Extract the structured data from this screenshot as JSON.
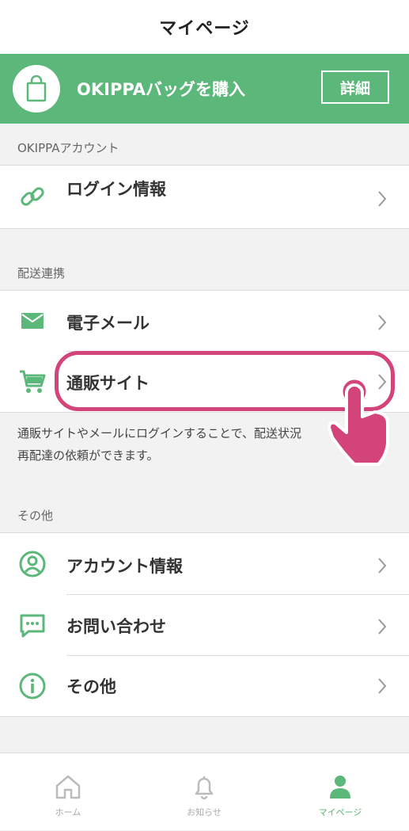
{
  "header": {
    "title": "マイページ"
  },
  "banner": {
    "text": "OKIPPAバッグを購入",
    "detail_button": "詳細"
  },
  "sections": {
    "account": {
      "label": "OKIPPAアカウント"
    },
    "delivery": {
      "label": "配送連携"
    },
    "other": {
      "label": "その他"
    }
  },
  "rows": {
    "login": {
      "label": "ログイン情報",
      "icon": "link-icon"
    },
    "email": {
      "label": "電子メール",
      "icon": "mail-icon"
    },
    "ecsite": {
      "label": "通販サイト",
      "icon": "cart-icon"
    },
    "account_info": {
      "label": "アカウント情報",
      "icon": "user-circle-icon"
    },
    "contact": {
      "label": "お問い合わせ",
      "icon": "chat-icon"
    },
    "other": {
      "label": "その他",
      "icon": "info-icon"
    }
  },
  "note": {
    "line1": "通販サイトやメールにログインすることで、配送状況",
    "line2": "再配達の依頼ができます。"
  },
  "tabbar": {
    "home": "ホーム",
    "notifications": "お知らせ",
    "mypage": "マイページ"
  },
  "colors": {
    "accent": "#5cb77a",
    "highlight": "#d2447a"
  }
}
